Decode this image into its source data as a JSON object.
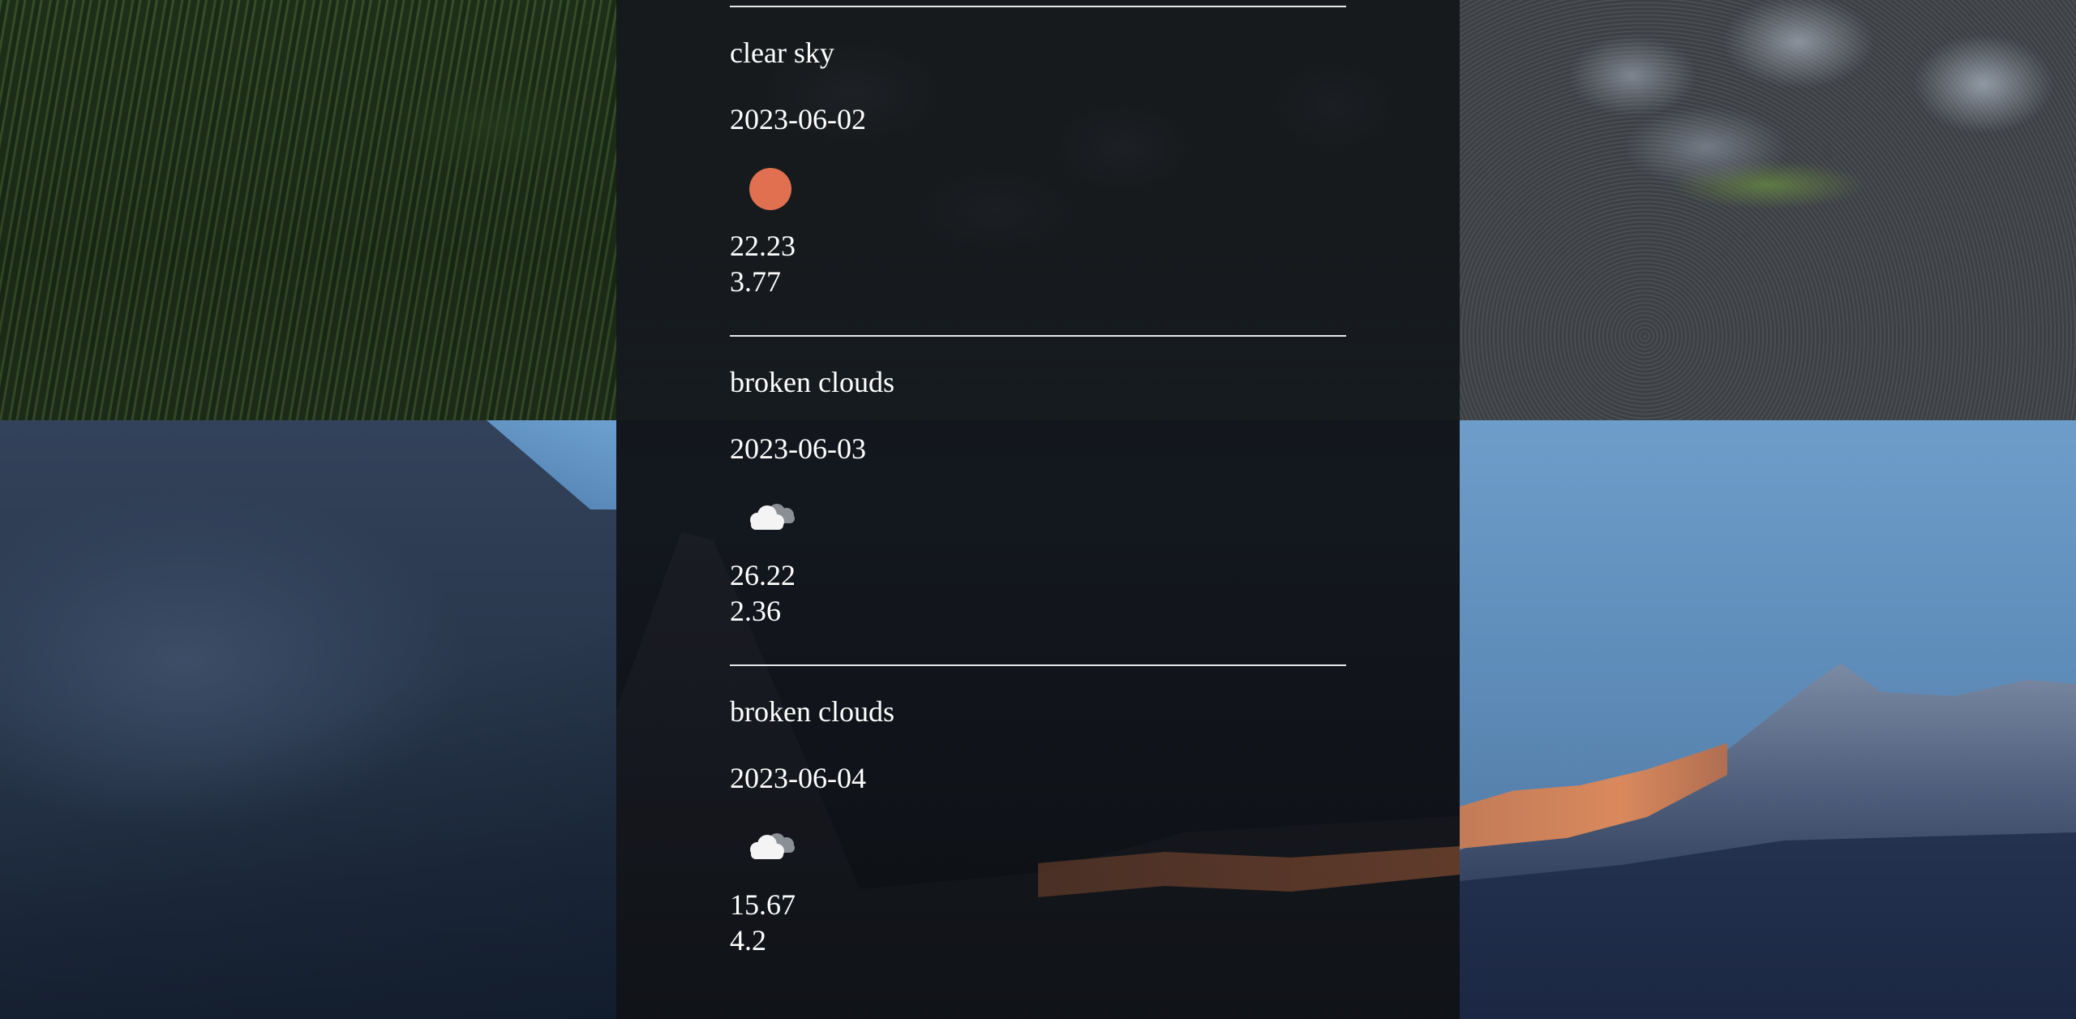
{
  "forecast": [
    {
      "description": "clear sky",
      "date": "2023-06-02",
      "icon": "sun-icon",
      "temperature": "22.23",
      "wind_speed": "3.77"
    },
    {
      "description": "broken clouds",
      "date": "2023-06-03",
      "icon": "broken-clouds-icon",
      "temperature": "26.22",
      "wind_speed": "2.36"
    },
    {
      "description": "broken clouds",
      "date": "2023-06-04",
      "icon": "broken-clouds-icon",
      "temperature": "15.67",
      "wind_speed": "4.2"
    }
  ],
  "colors": {
    "sun": "#e0704f",
    "cloud_front": "#f4f4f4",
    "cloud_back": "#8a8f96",
    "divider": "#e8e8e8",
    "text": "#ffffff"
  }
}
